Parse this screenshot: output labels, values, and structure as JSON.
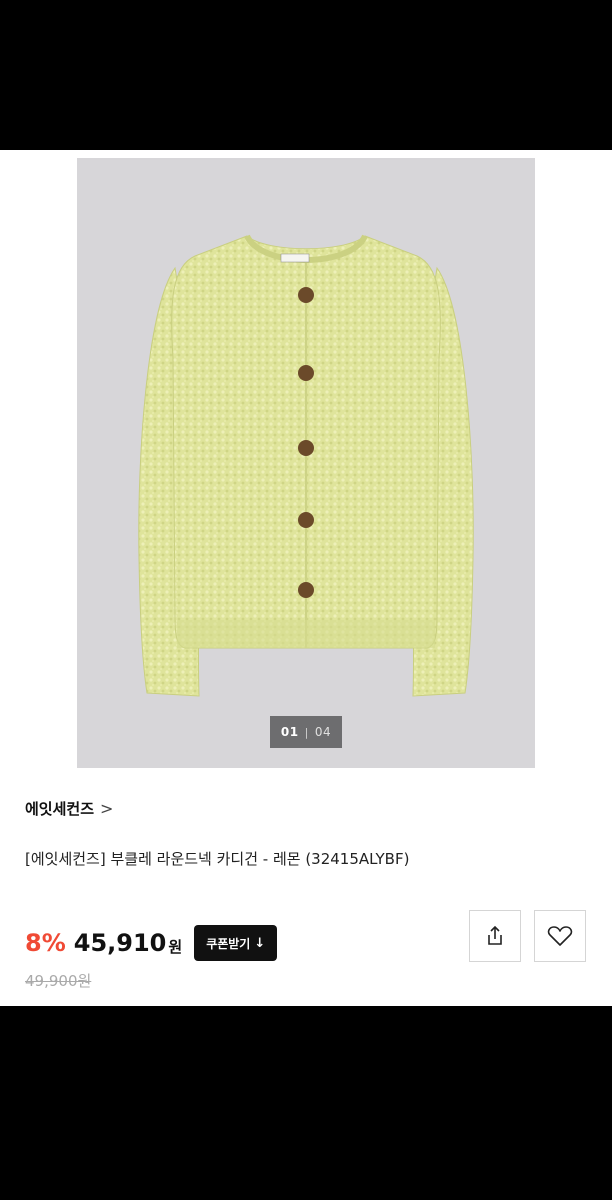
{
  "gallery": {
    "current": "01",
    "separator": "|",
    "total": "04"
  },
  "brand": {
    "name": "에잇세컨즈",
    "chevron": ">"
  },
  "product": {
    "name": "[에잇세컨즈] 부클레 라운드넥 카디건 - 레몬 (32415ALYBF)"
  },
  "pricing": {
    "discount": "8%",
    "price": "45,910",
    "currency": "원",
    "original": "49,900원",
    "coupon_label": "쿠폰받기",
    "coupon_icon": "↓"
  },
  "icons": {
    "share": "share-icon",
    "wishlist": "heart-icon"
  },
  "colors": {
    "discount": "#f04a35",
    "cardigan": "#dfe49b"
  }
}
